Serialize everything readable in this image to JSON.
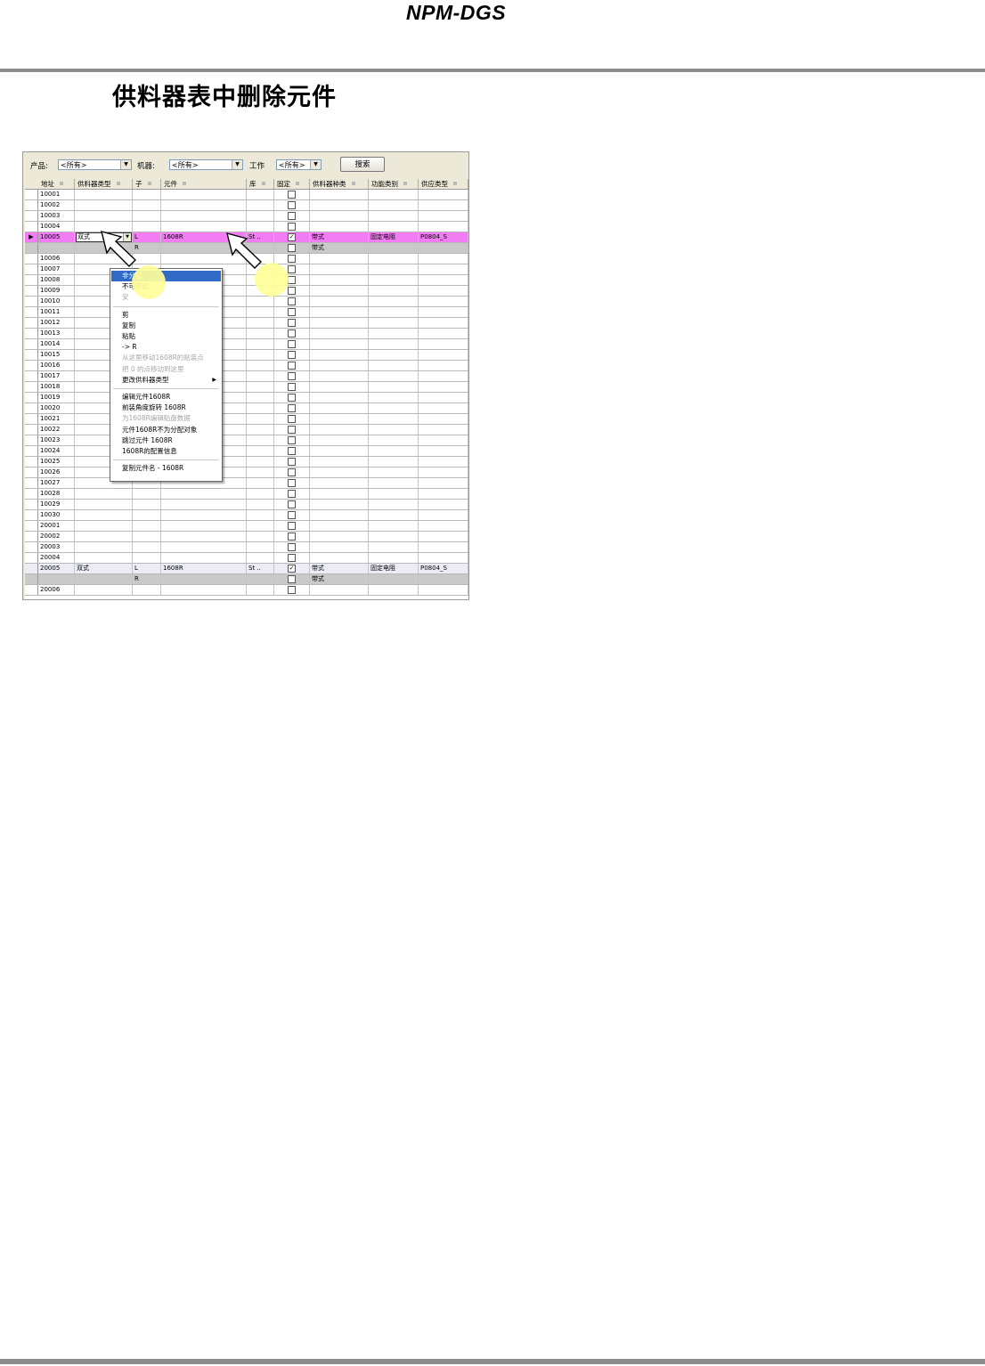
{
  "header": {
    "brand": "NPM-DGS"
  },
  "section": {
    "title": "供料器表中删除元件"
  },
  "filters": {
    "product_label": "产品:",
    "product_value": "<所有>",
    "machine_label": "机器:",
    "machine_value": "<所有>",
    "work_label": "工作",
    "work_value": "<所有>",
    "search_button": "搜索"
  },
  "columns": [
    "地址",
    "供料器类型",
    "子",
    "元件",
    "库",
    "固定",
    "供料器种类",
    "功能类别",
    "供应类型"
  ],
  "rows": [
    {
      "addr": "10001",
      "fixed": false
    },
    {
      "addr": "10002",
      "fixed": false
    },
    {
      "addr": "10003",
      "fixed": false
    },
    {
      "addr": "10004",
      "fixed": false
    },
    {
      "addr": "10005",
      "feeder_type": "双式",
      "sub": "L",
      "part": "1608R",
      "lib": "St ..",
      "fixed": true,
      "feeder_kind": "带式",
      "func": "固定电阻",
      "supply": "P0804_S",
      "style": "selected",
      "current": true
    },
    {
      "addr": "",
      "sub": "R",
      "fixed": false,
      "feeder_kind": "带式",
      "style": "sub"
    },
    {
      "addr": "10006",
      "fixed": false
    },
    {
      "addr": "10007",
      "fixed": false
    },
    {
      "addr": "10008",
      "fixed": false
    },
    {
      "addr": "10009",
      "fixed": false
    },
    {
      "addr": "10010",
      "fixed": false
    },
    {
      "addr": "10011",
      "fixed": false
    },
    {
      "addr": "10012",
      "fixed": false
    },
    {
      "addr": "10013",
      "fixed": false
    },
    {
      "addr": "10014",
      "fixed": false
    },
    {
      "addr": "10015",
      "fixed": false
    },
    {
      "addr": "10016",
      "fixed": false
    },
    {
      "addr": "10017",
      "fixed": false
    },
    {
      "addr": "10018",
      "fixed": false
    },
    {
      "addr": "10019",
      "fixed": false
    },
    {
      "addr": "10020",
      "fixed": false
    },
    {
      "addr": "10021",
      "fixed": false
    },
    {
      "addr": "10022",
      "fixed": false
    },
    {
      "addr": "10023",
      "fixed": false
    },
    {
      "addr": "10024",
      "fixed": false
    },
    {
      "addr": "10025",
      "fixed": false
    },
    {
      "addr": "10026",
      "fixed": false
    },
    {
      "addr": "10027",
      "fixed": false
    },
    {
      "addr": "10028",
      "fixed": false
    },
    {
      "addr": "10029",
      "fixed": false
    },
    {
      "addr": "10030",
      "fixed": false
    },
    {
      "addr": "20001",
      "fixed": false
    },
    {
      "addr": "20002",
      "fixed": false
    },
    {
      "addr": "20003",
      "fixed": false
    },
    {
      "addr": "20004",
      "fixed": false
    },
    {
      "addr": "20005",
      "feeder_type": "双式",
      "sub": "L",
      "part": "1608R",
      "lib": "St ..",
      "fixed": true,
      "feeder_kind": "带式",
      "func": "固定电阻",
      "supply": "P0804_S",
      "style": "highlight"
    },
    {
      "addr": "",
      "sub": "R",
      "fixed": false,
      "feeder_kind": "带式",
      "style": "sub"
    },
    {
      "addr": "20006",
      "fixed": false
    }
  ],
  "context_menu": [
    {
      "label": "非分配",
      "state": "active"
    },
    {
      "label": "不可移动",
      "state": "normal"
    },
    {
      "label": "安",
      "state": "disabled"
    },
    {
      "sep": true
    },
    {
      "label": "剪",
      "state": "normal"
    },
    {
      "label": "复制",
      "state": "normal"
    },
    {
      "label": "粘贴",
      "state": "normal"
    },
    {
      "label": "-> R",
      "state": "normal"
    },
    {
      "label": "从这里移动1608R的贴装点",
      "state": "disabled"
    },
    {
      "label": "把 0 的点移动到这里",
      "state": "disabled"
    },
    {
      "label": "更改供料器类型",
      "state": "normal",
      "submenu": true
    },
    {
      "sep": true
    },
    {
      "label": "编辑元件1608R",
      "state": "normal"
    },
    {
      "label": "前装角度旋转 1608R",
      "state": "normal"
    },
    {
      "label": "为1608R编辑贴盘数据",
      "state": "disabled"
    },
    {
      "label": "元件1608R不为分配对象",
      "state": "normal"
    },
    {
      "label": "跳过元件 1608R",
      "state": "normal"
    },
    {
      "label": "1608R的配置信息",
      "state": "normal"
    },
    {
      "sep": true
    },
    {
      "label": "复制元件名 - 1608R",
      "state": "normal"
    }
  ],
  "editor": {
    "value": "双式"
  },
  "colors": {
    "selected_row": "#f17cf3",
    "menu_highlight": "#316ac5",
    "callout": "#ffff99"
  }
}
